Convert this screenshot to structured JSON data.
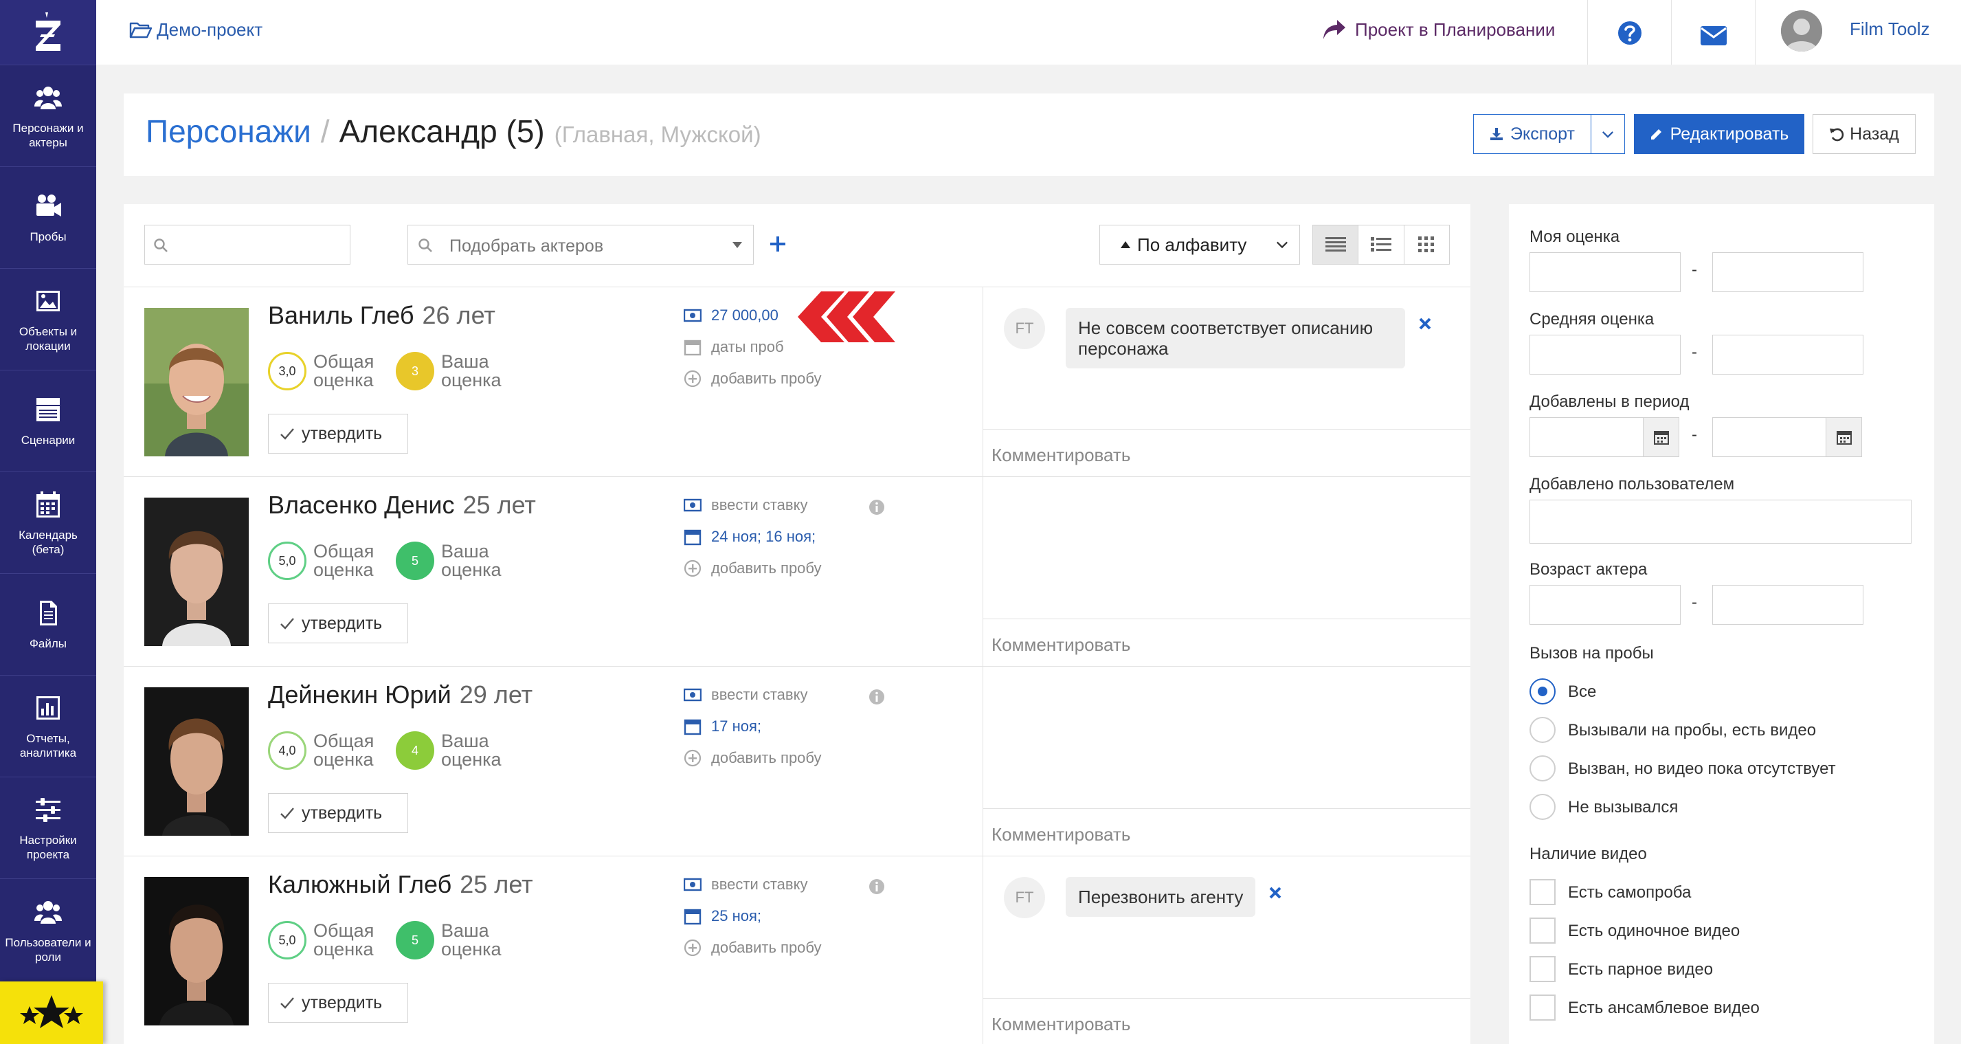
{
  "sidebar": {
    "items": [
      {
        "label": "Персонажи и актеры",
        "icon": "users-icon"
      },
      {
        "label": "Пробы",
        "icon": "video-camera-icon"
      },
      {
        "label": "Объекты и локации",
        "icon": "image-icon"
      },
      {
        "label": "Сценарии",
        "icon": "clapperboard-icon"
      },
      {
        "label": "Календарь (бета)",
        "icon": "calendar-icon"
      },
      {
        "label": "Файлы",
        "icon": "file-icon"
      },
      {
        "label": "Отчеты, аналитика",
        "icon": "bar-chart-icon"
      },
      {
        "label": "Настройки проекта",
        "icon": "sliders-icon"
      },
      {
        "label": "Пользователи и роли",
        "icon": "user-roles-icon"
      }
    ]
  },
  "topbar": {
    "project": "Демо-проект",
    "planning": "Проект в Планировании",
    "user": "Film Toolz"
  },
  "header": {
    "section": "Персонажи",
    "separator": "/",
    "character": "Александр (5)",
    "details": "(Главная, Мужской)",
    "export": "Экспорт",
    "edit": "Редактировать",
    "back": "Назад"
  },
  "toolbar": {
    "actor_placeholder": "Подобрать актеров",
    "sort": "По алфавиту"
  },
  "labels": {
    "overall_1": "Общая",
    "overall_2": "оценка",
    "yours_1": "Ваша",
    "yours_2": "оценка",
    "approve": "утвердить",
    "add_test": "добавить пробу",
    "comment": "Комментировать"
  },
  "actors": [
    {
      "name": "Ваниль Глеб",
      "age": "26 лет",
      "overall": "3,0",
      "yours": "3",
      "rate": "27 000,00",
      "dates": "даты проб",
      "comment": "Не совсем соответствует описанию персонажа"
    },
    {
      "name": "Власенко Денис",
      "age": "25 лет",
      "overall": "5,0",
      "yours": "5",
      "rate": "ввести ставку",
      "dates": "24 ноя; 16 ноя;",
      "comment": ""
    },
    {
      "name": "Дейнекин Юрий",
      "age": "29 лет",
      "overall": "4,0",
      "yours": "4",
      "rate": "ввести ставку",
      "dates": "17 ноя;",
      "comment": ""
    },
    {
      "name": "Калюжный Глеб",
      "age": "25 лет",
      "overall": "5,0",
      "yours": "5",
      "rate": "ввести ставку",
      "dates": "25 ноя;",
      "comment": "Перезвонить агенту"
    }
  ],
  "comment_author": "FT",
  "filters": {
    "my_rating": "Моя оценка",
    "avg_rating": "Средняя оценка",
    "added_period": "Добавлены в период",
    "added_by": "Добавлено пользователем",
    "actor_age": "Возраст актера",
    "dash": "-",
    "test_call": "Вызов на пробы",
    "test_call_options": [
      "Все",
      "Вызывали на пробы, есть видео",
      "Вызван, но видео пока отсутствует",
      "Не вызывался"
    ],
    "video": "Наличие видео",
    "video_options": [
      "Есть самопроба",
      "Есть одиночное видео",
      "Есть парное видео",
      "Есть ансамблевое видео"
    ]
  },
  "colors": {
    "sidebar": "#27276f",
    "accent": "#2262c6",
    "link": "#2a6fd1",
    "planning": "#5c2a66",
    "star_box": "#f5e10a",
    "score_yellow": "#e8c72a",
    "score_green": "#3fbf6a",
    "arrow_red": "#e3262b"
  }
}
